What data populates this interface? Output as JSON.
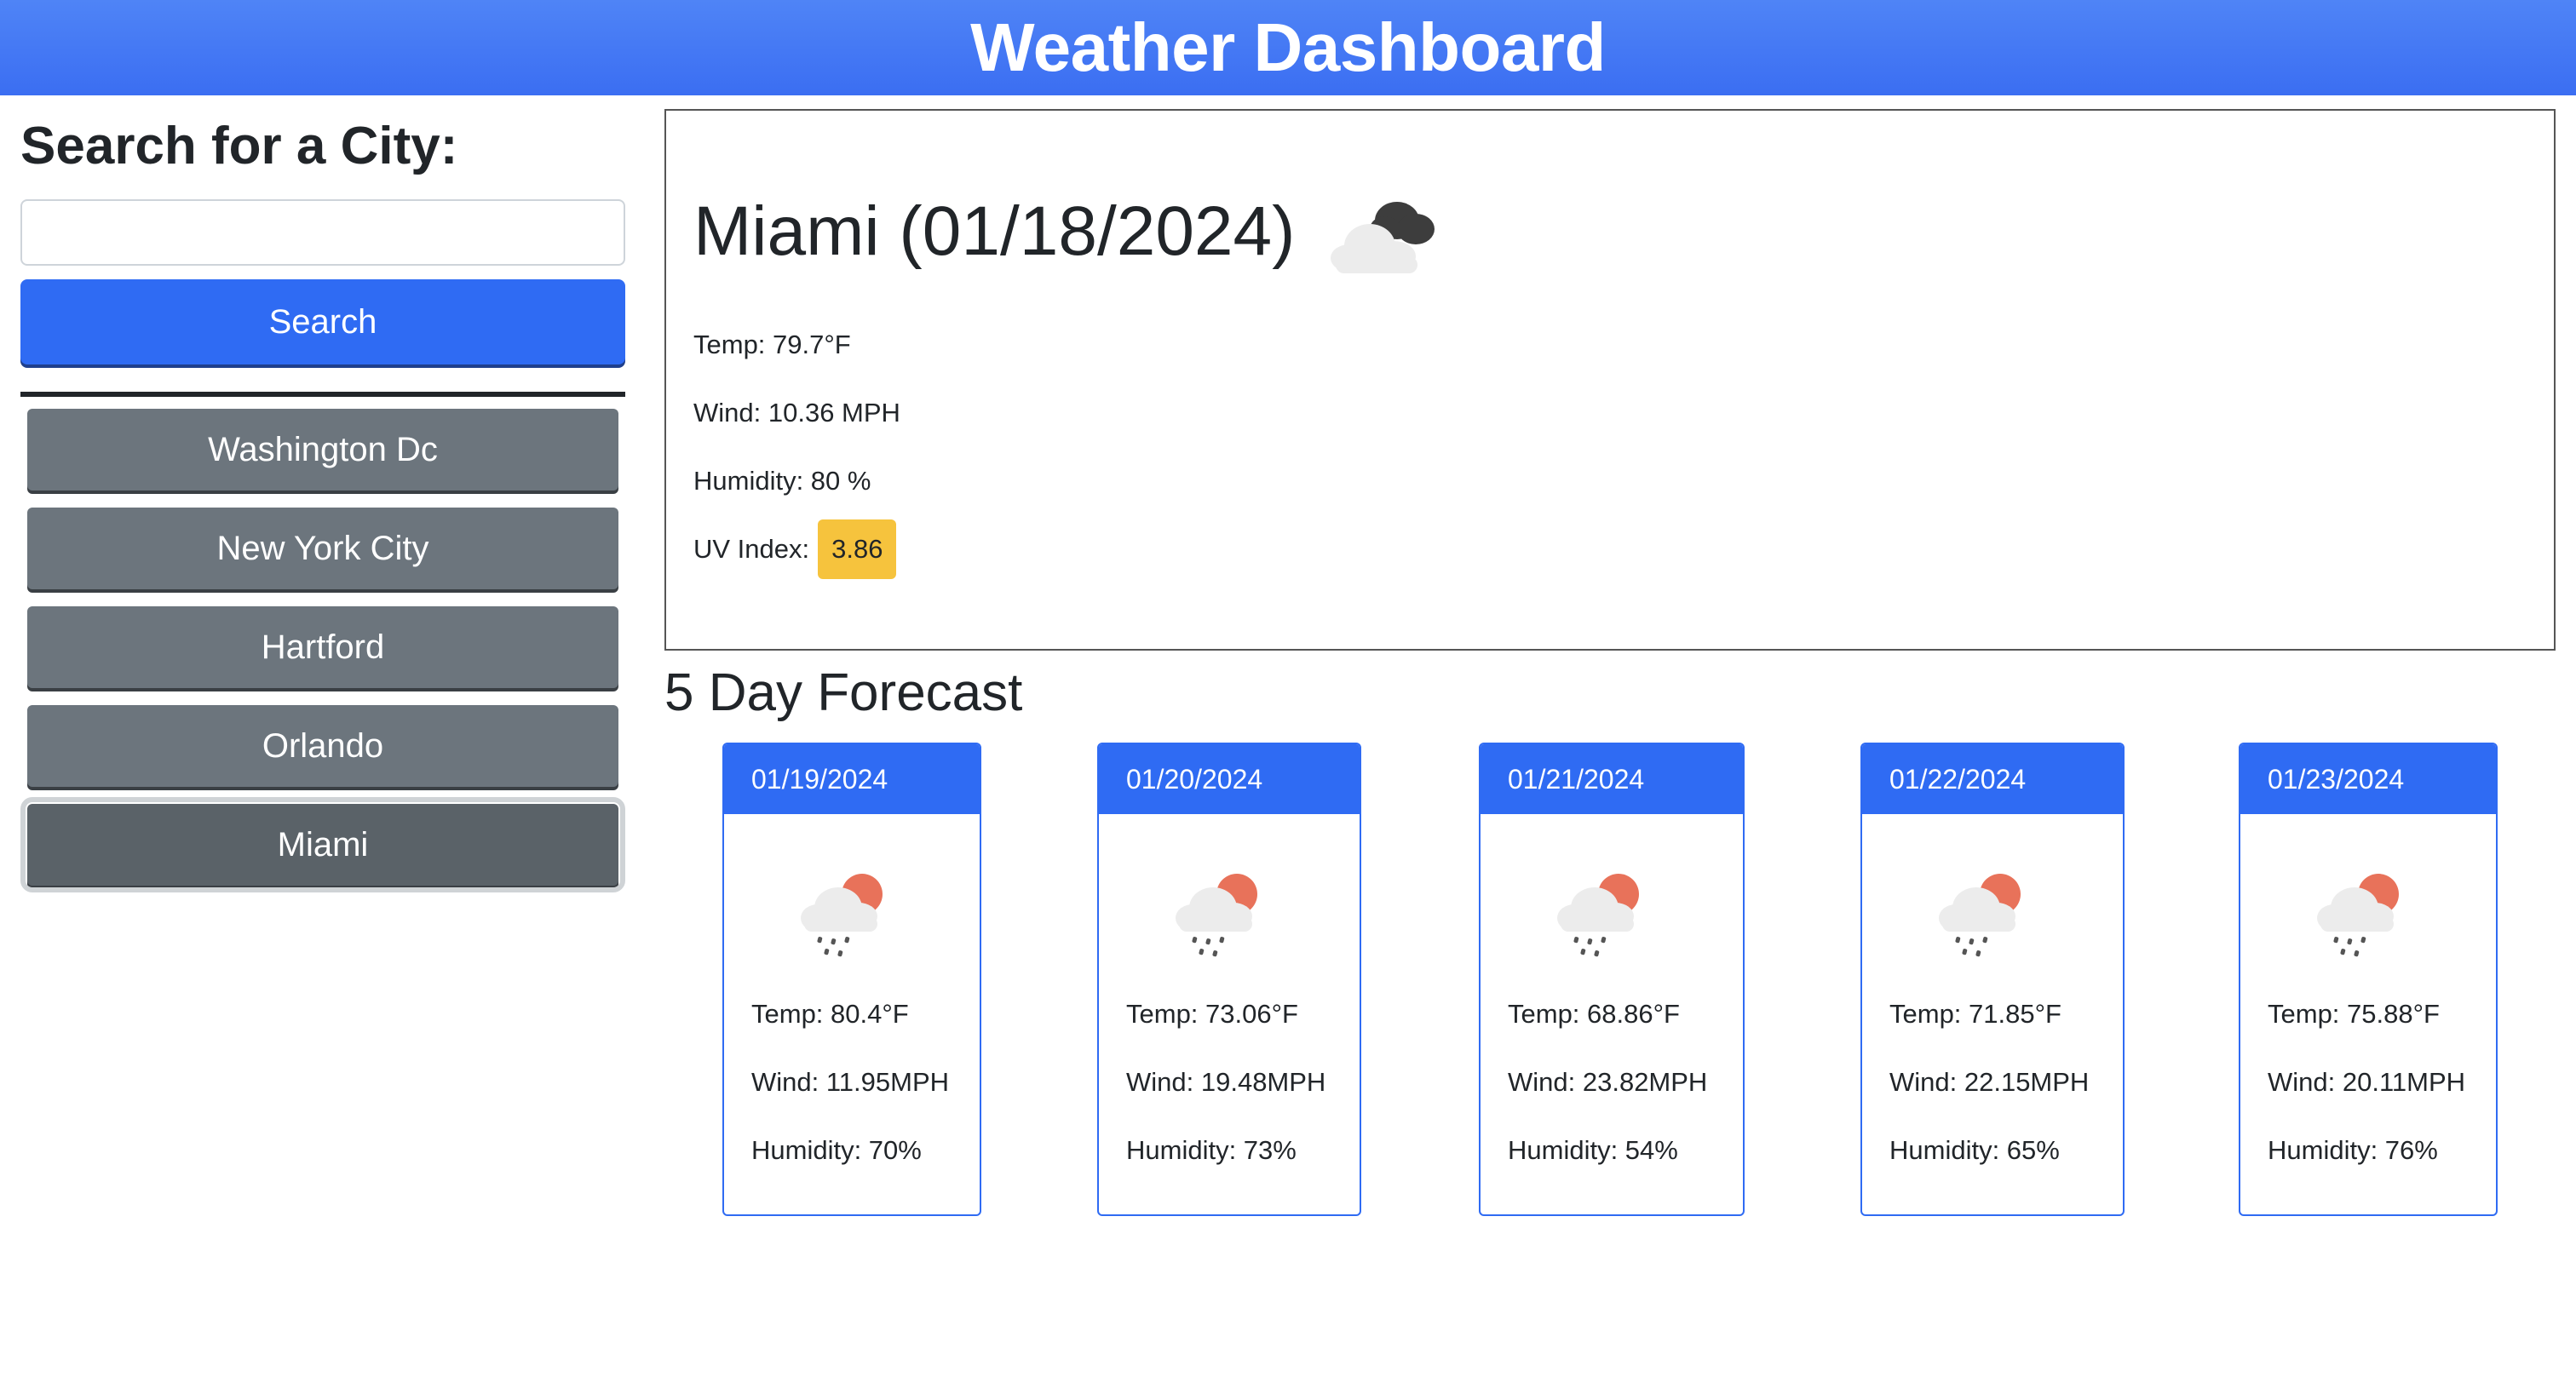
{
  "header": {
    "title": "Weather Dashboard"
  },
  "sidebar": {
    "heading": "Search for a City:",
    "search": {
      "value": "",
      "placeholder": "",
      "button_label": "Search"
    },
    "history": [
      {
        "label": "Washington Dc"
      },
      {
        "label": "New York City"
      },
      {
        "label": "Hartford"
      },
      {
        "label": "Orlando"
      },
      {
        "label": "Miami"
      }
    ],
    "active_city": "Miami"
  },
  "current": {
    "title": "Miami (01/18/2024)",
    "icon": "cloudy-icon",
    "temp": "Temp: 79.7°F",
    "wind": "Wind: 10.36 MPH",
    "humidity": "Humidity: 80 %",
    "uv_label": "UV Index:",
    "uv_value": "3.86"
  },
  "forecast": {
    "title": "5 Day Forecast",
    "days": [
      {
        "date": "01/19/2024",
        "icon": "rain-sun-icon",
        "temp": "Temp: 80.4°F",
        "wind": "Wind: 11.95MPH",
        "humidity": "Humidity: 70%"
      },
      {
        "date": "01/20/2024",
        "icon": "rain-sun-icon",
        "temp": "Temp: 73.06°F",
        "wind": "Wind: 19.48MPH",
        "humidity": "Humidity: 73%"
      },
      {
        "date": "01/21/2024",
        "icon": "rain-sun-icon",
        "temp": "Temp: 68.86°F",
        "wind": "Wind: 23.82MPH",
        "humidity": "Humidity: 54%"
      },
      {
        "date": "01/22/2024",
        "icon": "rain-sun-icon",
        "temp": "Temp: 71.85°F",
        "wind": "Wind: 22.15MPH",
        "humidity": "Humidity: 65%"
      },
      {
        "date": "01/23/2024",
        "icon": "rain-sun-icon",
        "temp": "Temp: 75.88°F",
        "wind": "Wind: 20.11MPH",
        "humidity": "Humidity: 76%"
      }
    ]
  },
  "colors": {
    "header": "#3b6ef2",
    "primary": "#2f6bf3",
    "city_button": "#6c757d",
    "uv_moderate": "#f6c33d"
  }
}
